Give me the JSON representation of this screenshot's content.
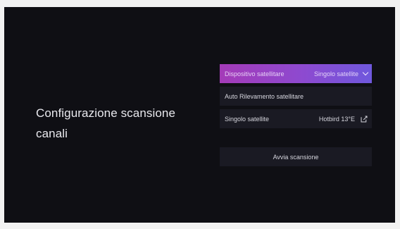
{
  "page": {
    "title": "Configurazione scansione canali"
  },
  "settings": {
    "device": {
      "label": "Dispositivo satellitare",
      "value": "Singolo satellite",
      "icon": "chevron-down-icon"
    },
    "auto_detect": {
      "label": "Auto Rilevamento satellitare"
    },
    "single_satellite": {
      "label": "Singolo satellite",
      "value": "Hotbird 13°E",
      "icon": "edit-icon"
    }
  },
  "actions": {
    "start_scan_label": "Avvia scansione"
  },
  "colors": {
    "background": "#0f0f14",
    "row_background": "#1a1a23",
    "focus_gradient_start": "#a43bb8",
    "focus_gradient_end": "#6f58dd",
    "text": "#d6d6de"
  }
}
